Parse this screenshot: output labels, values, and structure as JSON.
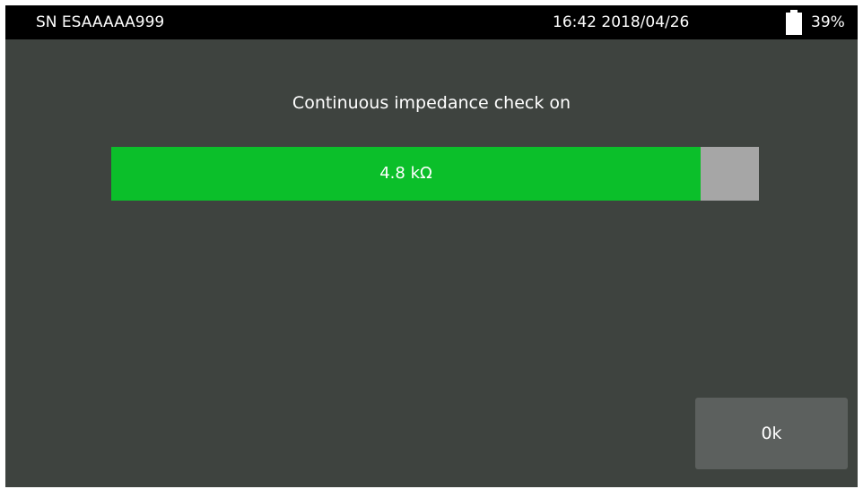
{
  "status_bar": {
    "serial": "SN ESAAAAA999",
    "datetime": "16:42 2018/04/26",
    "battery_icon": "battery-icon",
    "battery_percent": "39%",
    "battery_level": 0.39
  },
  "dialog": {
    "title": "Continuous impedance check on",
    "impedance_value": "4.8 kΩ",
    "impedance_fraction": 0.91,
    "ok_label": "0k"
  },
  "colors": {
    "background": "#3e433f",
    "status_bar": "#000000",
    "bar_fill": "#0bbf2a",
    "bar_track": "#a6a6a6",
    "button": "#5c605e",
    "text": "#ffffff"
  }
}
